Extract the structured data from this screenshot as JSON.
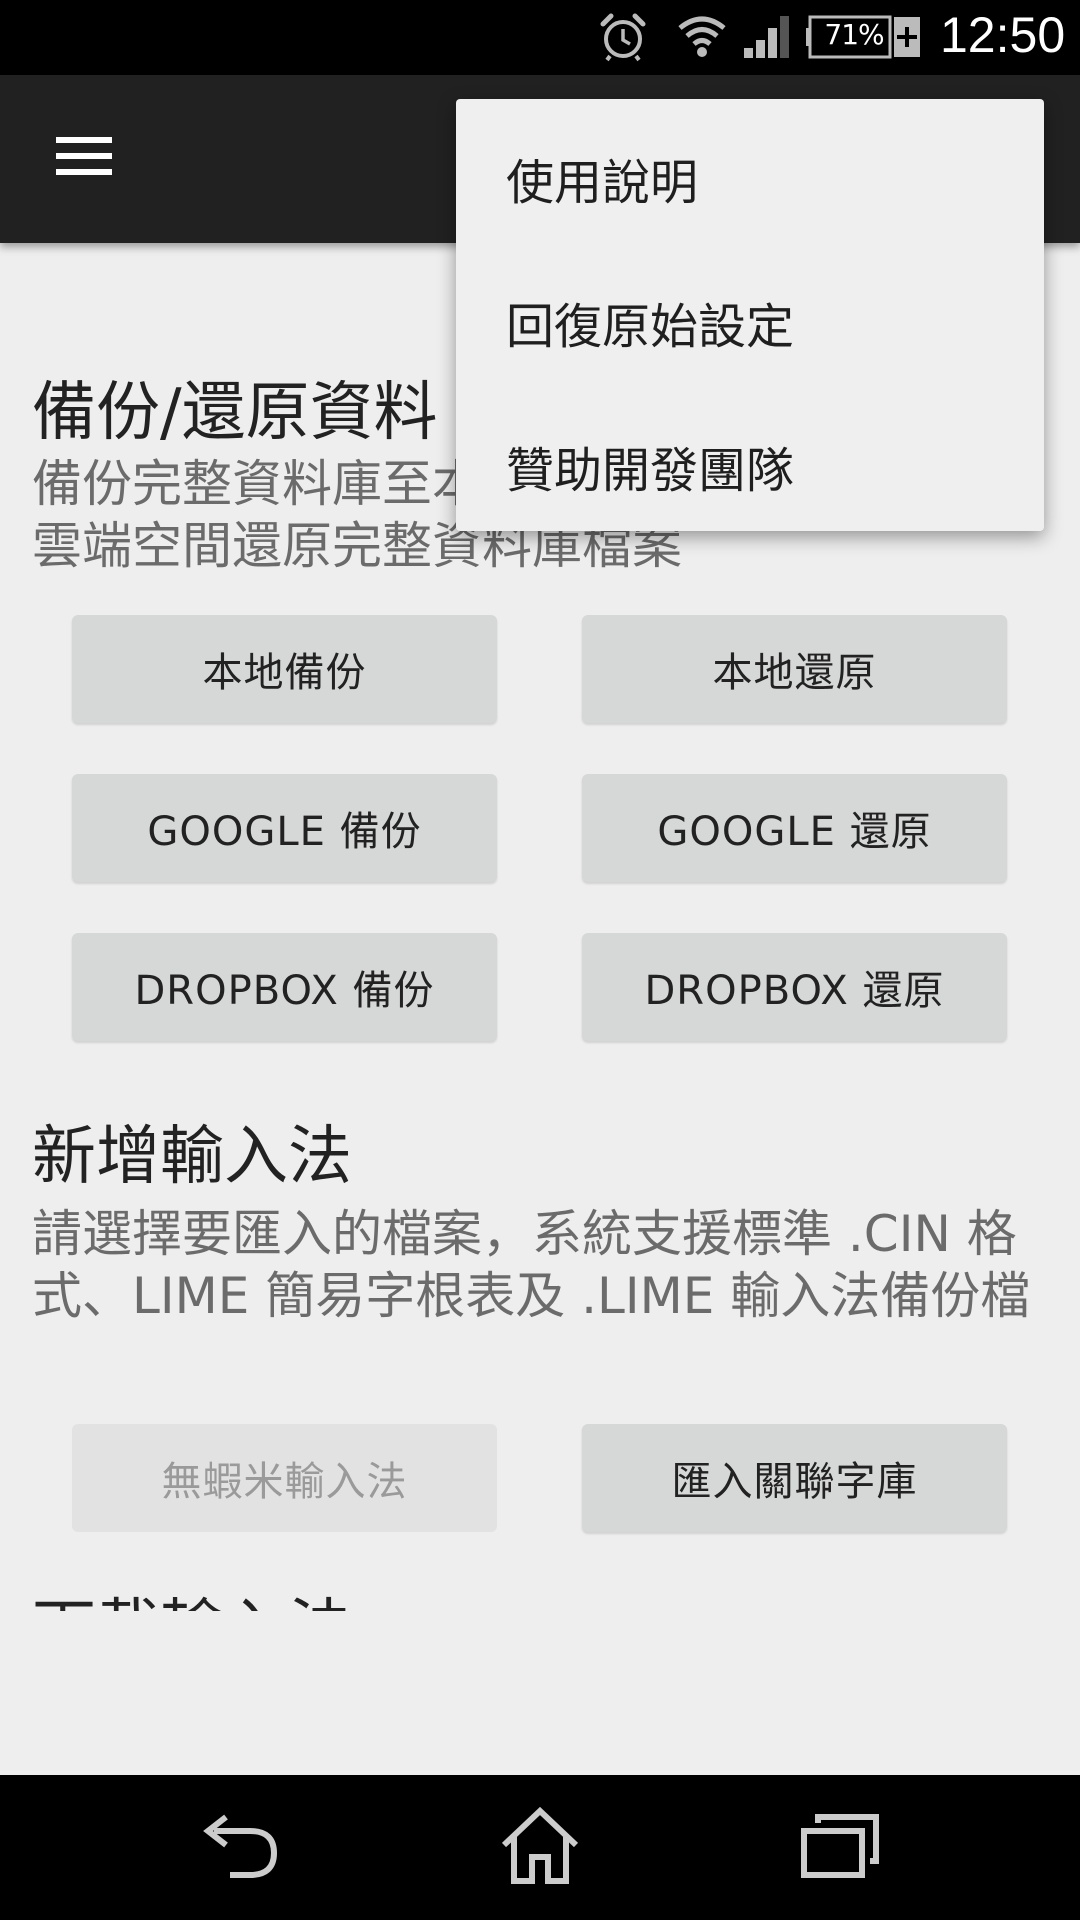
{
  "status_bar": {
    "battery_level": "71%",
    "time": "12:50",
    "icons": [
      "alarm-icon",
      "wifi-icon",
      "signal-icon",
      "battery-charging-icon"
    ]
  },
  "toolbar": {
    "menu_icon": "hamburger-menu-icon"
  },
  "sections": {
    "backup": {
      "title": "備份/還原資料",
      "description": "備份完整資料庫至本地/雲端空間，或從本地/雲端空間還原完整資料庫檔案",
      "buttons": [
        "本地備份",
        "本地還原",
        "GOOGLE 備份",
        "GOOGLE 還原",
        "DROPBOX 備份",
        "DROPBOX 還原"
      ]
    },
    "add_ime": {
      "title": "新增輸入法",
      "description": "請選擇要匯入的檔案，系統支援標準 .CIN 格式、LIME 簡易字根表及 .LIME 輸入法備份檔",
      "buttons": [
        "無蝦米輸入法",
        "匯入關聯字庫"
      ]
    },
    "download": {
      "title": "下載輸入法"
    }
  },
  "popup_menu": {
    "items": [
      "使用說明",
      "回復原始設定",
      "贊助開發團隊"
    ]
  },
  "nav_bar": {
    "icons": [
      "back-icon",
      "home-icon",
      "recents-icon"
    ]
  },
  "colors": {
    "toolbar": "#212121",
    "background": "#eeeeee",
    "button": "#d6d7d7",
    "status_bar": "#000000"
  }
}
